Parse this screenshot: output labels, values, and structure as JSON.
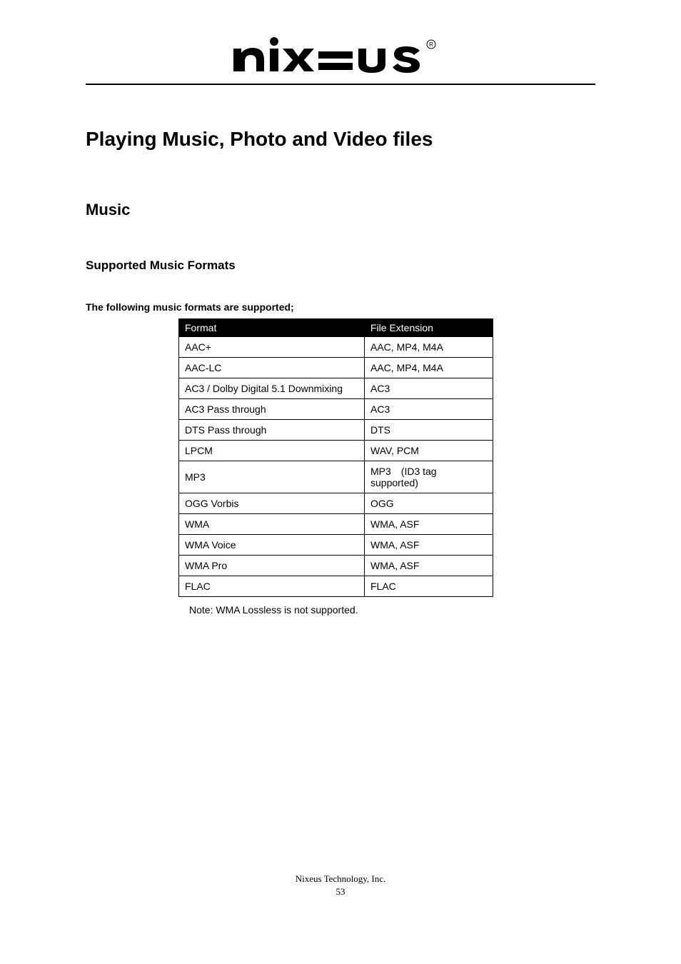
{
  "logo_alt": "NIXEUS",
  "main_title": "Playing Music, Photo and Video files",
  "sub_title": "Music",
  "section_title": "Supported Music Formats",
  "lead_text": "The following music formats are supported;",
  "table": {
    "headers": [
      "Format",
      "File Extension"
    ],
    "rows": [
      {
        "format": "AAC+",
        "ext": "AAC, MP4, M4A"
      },
      {
        "format": "AAC-LC",
        "ext": "AAC, MP4, M4A"
      },
      {
        "format": "AC3 / Dolby Digital 5.1 Downmixing",
        "ext": "AC3"
      },
      {
        "format": "AC3 Pass through",
        "ext": "AC3"
      },
      {
        "format": "DTS Pass through",
        "ext": "DTS"
      },
      {
        "format": "LPCM",
        "ext": "WAV, PCM"
      },
      {
        "format": "MP3",
        "ext": "MP3 (ID3 tag supported)"
      },
      {
        "format": "OGG Vorbis",
        "ext": "OGG"
      },
      {
        "format": "WMA",
        "ext": "WMA, ASF"
      },
      {
        "format": "WMA Voice",
        "ext": "WMA, ASF"
      },
      {
        "format": "WMA Pro",
        "ext": "WMA, ASF"
      },
      {
        "format": "FLAC",
        "ext": "FLAC"
      }
    ]
  },
  "note": "Note: WMA Lossless is not supported.",
  "footer": {
    "company": "Nixeus Technology, Inc.",
    "page": "53"
  }
}
